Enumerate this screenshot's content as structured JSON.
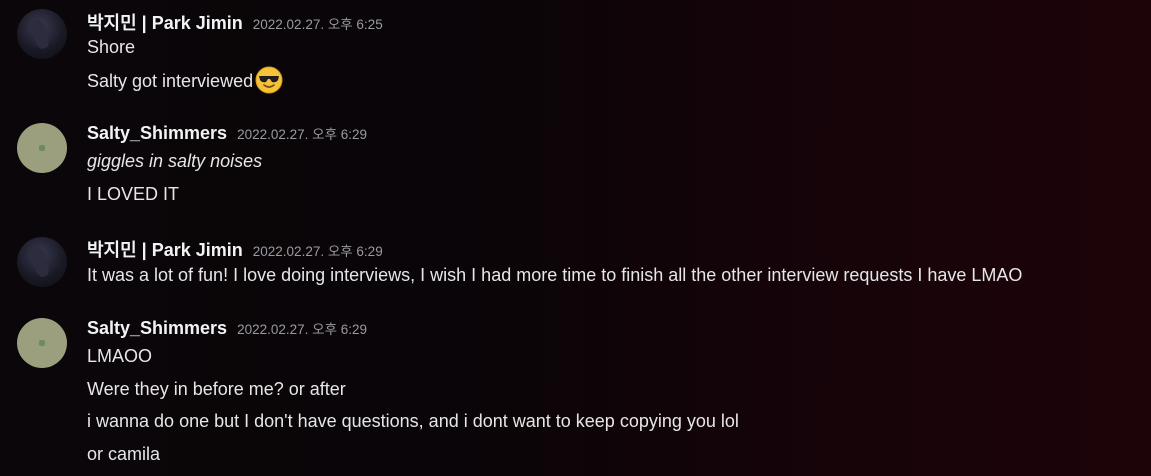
{
  "messages": [
    {
      "author": "박지민 | Park Jimin",
      "timestamp": "2022.02.27. 오후 6:25",
      "lines": [
        "Shore",
        "Salty got interviewed"
      ],
      "emoji": "sunglasses-emoji"
    },
    {
      "author": "Salty_Shimmers",
      "timestamp": "2022.02.27. 오후 6:29",
      "lines": [
        "giggles in salty noises",
        "I LOVED IT"
      ]
    },
    {
      "author": "박지민 | Park Jimin",
      "timestamp": "2022.02.27. 오후 6:29",
      "lines": [
        "It was a lot of fun! I love doing interviews, I wish I had more time to finish all the other interview requests I have LMAO"
      ]
    },
    {
      "author": "Salty_Shimmers",
      "timestamp": "2022.02.27. 오후 6:29",
      "lines": [
        "LMAOO",
        "Were they in before me? or after",
        "i wanna do one but I don't have questions, and i dont want to keep copying you lol",
        "or camila"
      ]
    }
  ]
}
